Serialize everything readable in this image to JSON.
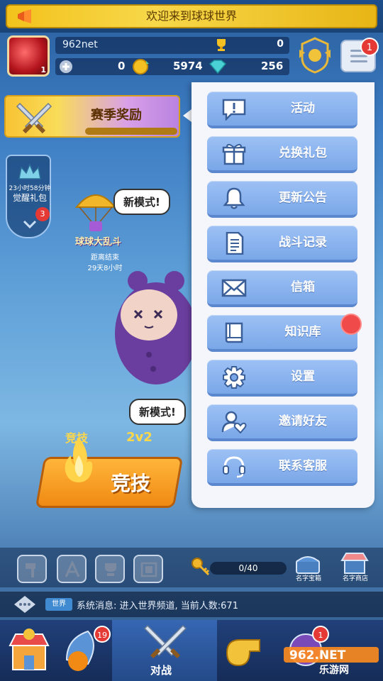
{
  "header": {
    "welcome_text": "欢迎来到球球世界"
  },
  "player": {
    "name": "962net",
    "avatar_level": "1",
    "trophies": "0",
    "currency_a": "0",
    "currency_b": "5974",
    "currency_c": "256",
    "menu_badge": "1"
  },
  "season": {
    "title": "赛季奖励"
  },
  "gift_pack": {
    "timer": "23小时58分钟",
    "label": "觉醒礼包",
    "badge": "3"
  },
  "event": {
    "bubble_text": "新模式!",
    "mode_name": "球球大乱斗",
    "status_line1": "距离结束",
    "status_line2": "29天8小时"
  },
  "battle": {
    "bubble_text": "新模式!",
    "ranked_label": "竞技",
    "mode_2v2": "2v2",
    "compete_label": "竞技"
  },
  "tools": {
    "key_progress": "0/40",
    "shop1_label": "名字宝箱",
    "shop2_label": "名字商店"
  },
  "chat": {
    "channel": "世界",
    "message": "系统消息: 进入世界频道, 当前人数:671"
  },
  "nav": {
    "active_label": "对战",
    "badge_1": "19",
    "badge_2": "1"
  },
  "watermark": {
    "text": "乐游网",
    "logo_text": "962.NET"
  },
  "menu": {
    "items": [
      {
        "label": "活动",
        "icon": "exclamation-bubble-icon"
      },
      {
        "label": "兑换礼包",
        "icon": "gift-icon"
      },
      {
        "label": "更新公告",
        "icon": "bell-icon"
      },
      {
        "label": "战斗记录",
        "icon": "document-icon"
      },
      {
        "label": "信箱",
        "icon": "envelope-icon"
      },
      {
        "label": "知识库",
        "icon": "book-icon"
      },
      {
        "label": "设置",
        "icon": "gear-icon"
      },
      {
        "label": "邀请好友",
        "icon": "invite-friend-icon"
      },
      {
        "label": "联系客服",
        "icon": "headset-icon"
      }
    ]
  },
  "colors": {
    "menu_button": "#7aa7e8",
    "panel_bg": "#f4f6fb",
    "notify_dot": "#f04a4a",
    "accent_gold": "#f3c21c"
  }
}
